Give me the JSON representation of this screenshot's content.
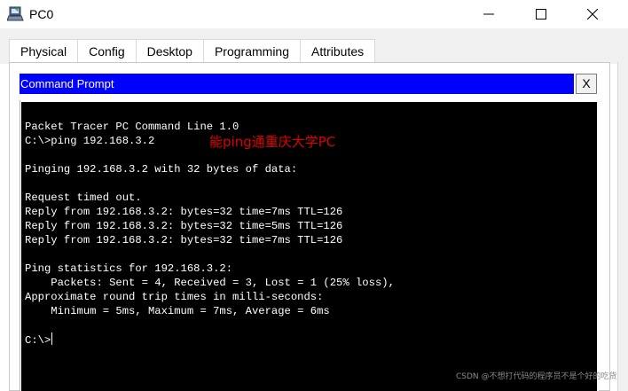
{
  "window": {
    "title": "PC0",
    "icon": "packet-tracer-pc-icon"
  },
  "tabs": [
    {
      "label": "Physical",
      "active": false
    },
    {
      "label": "Config",
      "active": false
    },
    {
      "label": "Desktop",
      "active": true
    },
    {
      "label": "Programming",
      "active": false
    },
    {
      "label": "Attributes",
      "active": false
    }
  ],
  "command_prompt": {
    "title": "Command Prompt",
    "close_label": "X",
    "lines": [
      "Packet Tracer PC Command Line 1.0",
      "C:\\>ping 192.168.3.2",
      "",
      "Pinging 192.168.3.2 with 32 bytes of data:",
      "",
      "Request timed out.",
      "Reply from 192.168.3.2: bytes=32 time=7ms TTL=126",
      "Reply from 192.168.3.2: bytes=32 time=5ms TTL=126",
      "Reply from 192.168.3.2: bytes=32 time=7ms TTL=126",
      "",
      "Ping statistics for 192.168.3.2:",
      "    Packets: Sent = 4, Received = 3, Lost = 1 (25% loss),",
      "Approximate round trip times in milli-seconds:",
      "    Minimum = 5ms, Maximum = 7ms, Average = 6ms",
      "",
      "C:\\>"
    ]
  },
  "annotation": "能ping通重庆大学PC",
  "watermark": "CSDN @不想打代码的程序员不是个好的吃货",
  "colors": {
    "header_blue": "#0000ff",
    "terminal_bg": "#000000",
    "terminal_fg": "#ffffff",
    "annotation_red": "#e00000",
    "active_tab_underline": "#2b4d7e"
  }
}
